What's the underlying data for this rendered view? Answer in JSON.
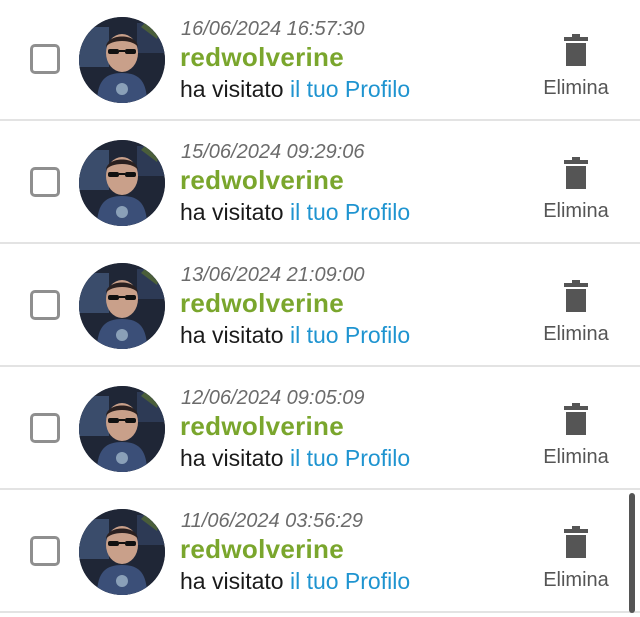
{
  "visits": [
    {
      "timestamp": "16/06/2024 16:57:30",
      "username": "redwolverine",
      "action_text": "ha visitato",
      "link_text": "il tuo Profilo",
      "delete_label": "Elimina"
    },
    {
      "timestamp": "15/06/2024 09:29:06",
      "username": "redwolverine",
      "action_text": "ha visitato",
      "link_text": "il tuo Profilo",
      "delete_label": "Elimina"
    },
    {
      "timestamp": "13/06/2024 21:09:00",
      "username": "redwolverine",
      "action_text": "ha visitato",
      "link_text": "il tuo Profilo",
      "delete_label": "Elimina"
    },
    {
      "timestamp": "12/06/2024 09:05:09",
      "username": "redwolverine",
      "action_text": "ha visitato",
      "link_text": "il tuo Profilo",
      "delete_label": "Elimina"
    },
    {
      "timestamp": "11/06/2024 03:56:29",
      "username": "redwolverine",
      "action_text": "ha visitato",
      "link_text": "il tuo Profilo",
      "delete_label": "Elimina"
    }
  ],
  "colors": {
    "username": "#7aa62d",
    "link": "#1f94d0",
    "timestamp": "#6b6b6b",
    "icon": "#555555"
  },
  "icons": {
    "delete": "trash-icon",
    "checkbox": "checkbox-unchecked"
  }
}
